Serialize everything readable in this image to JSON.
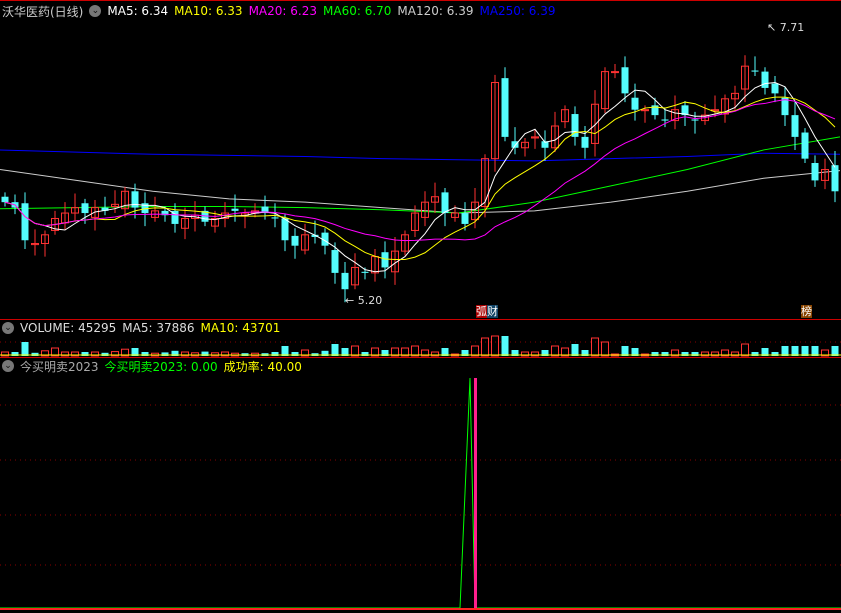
{
  "header": {
    "title": "沃华医药(日线)",
    "ma5": "MA5: 6.34",
    "ma10": "MA10: 6.33",
    "ma20": "MA20: 6.23",
    "ma60": "MA60: 6.70",
    "ma120": "MA120: 6.39",
    "ma250": "MA250: 6.39"
  },
  "price_labels": {
    "high": "7.71",
    "low": "5.20"
  },
  "markers": {
    "m1a": "弧",
    "m1b": "财",
    "m2": "榜"
  },
  "volume_header": {
    "volume": "VOLUME: 45295",
    "ma5": "MA5: 37886",
    "ma10": "MA10: 43701"
  },
  "indicator_header": {
    "name": "今买明卖2023",
    "value": "今买明卖2023: 0.00",
    "rate": "成功率: 40.00"
  },
  "colors": {
    "up": "#ff3232",
    "down": "#54fcfc",
    "ma5": "#ffffff",
    "ma10": "#ffff00",
    "ma20": "#ff00ff",
    "ma60": "#00ff00",
    "ma120": "#cccccc",
    "ma250": "#0000ff"
  },
  "chart_data": {
    "type": "candlestick",
    "closes": [
      6.1,
      6.05,
      5.75,
      5.72,
      5.8,
      5.95,
      6.0,
      6.05,
      6.0,
      6.05,
      6.02,
      6.08,
      6.2,
      6.05,
      6.0,
      6.02,
      5.98,
      5.9,
      5.95,
      5.98,
      5.92,
      5.95,
      6.0,
      6.02,
      6.0,
      6.02,
      6.0,
      5.95,
      5.75,
      5.7,
      5.8,
      5.78,
      5.7,
      5.45,
      5.3,
      5.5,
      5.45,
      5.6,
      5.5,
      5.65,
      5.8,
      6.0,
      6.1,
      6.15,
      6.0,
      6.0,
      5.9,
      6.1,
      6.5,
      7.2,
      6.7,
      6.6,
      6.65,
      6.7,
      6.6,
      6.8,
      6.95,
      6.7,
      6.6,
      7.0,
      7.3,
      7.3,
      7.1,
      6.95,
      6.95,
      6.9,
      6.85,
      6.95,
      6.9,
      6.85,
      6.9,
      6.95,
      7.05,
      7.1,
      7.35,
      7.3,
      7.15,
      7.1,
      6.9,
      6.7,
      6.5,
      6.3,
      6.4,
      6.2
    ],
    "ma60": [
      6.04,
      6.05,
      6.06,
      6.06,
      6.05,
      6.03,
      6.0,
      6.1,
      6.25,
      6.4,
      6.58,
      6.7
    ],
    "ma120": [
      6.4,
      6.3,
      6.2,
      6.13,
      6.1,
      6.05,
      6.0,
      6.02,
      6.1,
      6.2,
      6.32,
      6.39
    ],
    "ma250": [
      6.58,
      6.56,
      6.54,
      6.53,
      6.52,
      6.5,
      6.49,
      6.48,
      6.5,
      6.52,
      6.55,
      6.54
    ],
    "signal_index": 46
  }
}
